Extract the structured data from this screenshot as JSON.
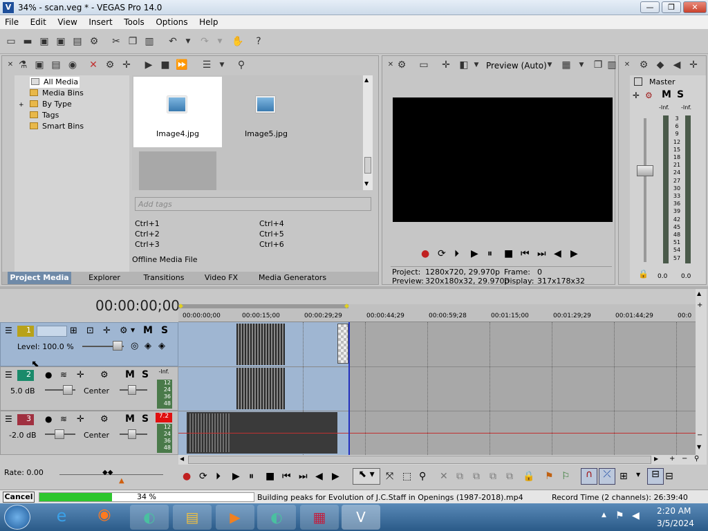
{
  "window": {
    "title": "34% - scan.veg * - VEGAS Pro 14.0",
    "app_icon": "vegas-icon",
    "min": "—",
    "max": "❐",
    "close": "✕"
  },
  "menu": [
    "File",
    "Edit",
    "View",
    "Insert",
    "Tools",
    "Options",
    "Help"
  ],
  "media": {
    "tree": [
      "All Media",
      "Media Bins",
      "By Type",
      "Tags",
      "Smart Bins"
    ],
    "tree_expander": "+",
    "files": [
      "Image4.jpg",
      "Image5.jpg"
    ],
    "tags_placeholder": "Add tags",
    "shortcuts": [
      "Ctrl+1",
      "Ctrl+4",
      "Ctrl+2",
      "Ctrl+5",
      "Ctrl+3",
      "Ctrl+6"
    ],
    "status": "Offline Media File",
    "tabs": [
      "Project Media",
      "Explorer",
      "Transitions",
      "Video FX",
      "Media Generators"
    ]
  },
  "preview": {
    "mode": "Preview (Auto)",
    "project_label": "Project:",
    "project_value": "1280x720, 29.970p",
    "frame_label": "Frame:",
    "frame_value": "0",
    "preview_label": "Preview:",
    "preview_value": "320x180x32, 29.970p",
    "display_label": "Display:",
    "display_value": "317x178x32"
  },
  "mixer": {
    "label": "Master",
    "mute": "M",
    "solo": "S",
    "inf_left": "-Inf.",
    "inf_right": "-Inf.",
    "scale": [
      "3",
      "6",
      "9",
      "12",
      "15",
      "18",
      "21",
      "24",
      "27",
      "30",
      "33",
      "36",
      "39",
      "42",
      "45",
      "48",
      "51",
      "54",
      "57"
    ],
    "bottom_left": "0.0",
    "bottom_right": "0.0"
  },
  "timeline": {
    "timecode": "00:00:00;00",
    "ruler": [
      "00:00:00;00",
      "00:00:15;00",
      "00:00:29;29",
      "00:00:44;29",
      "00:00:59;28",
      "00:01:15;00",
      "00:01:29;29",
      "00:01:44;29",
      "00:0"
    ],
    "tracks": [
      {
        "num": "1",
        "mute": "M",
        "solo": "S",
        "level": "Level: 100.0 %",
        "color": "#b8a21a"
      },
      {
        "num": "2",
        "mute": "M",
        "solo": "S",
        "vol": "5.0 dB",
        "pan": "Center",
        "peak": "-Inf.",
        "meter": [
          "12",
          "24",
          "36",
          "48"
        ],
        "color": "#1a8a6a"
      },
      {
        "num": "3",
        "mute": "M",
        "solo": "S",
        "vol": "-2.0 dB",
        "pan": "Center",
        "peak": "7.2",
        "meter": [
          "12",
          "24",
          "36",
          "48"
        ],
        "color": "#a03040"
      }
    ],
    "rate": "Rate: 0.00"
  },
  "status": {
    "cancel": "Cancel",
    "progress_text": "34 %",
    "progress": 0.34,
    "message": "Building peaks for Evolution of J.C.Staff in Openings (1987-2018).mp4",
    "record_time": "Record Time (2 channels): 26:39:40"
  },
  "taskbar": {
    "time": "2:20 AM",
    "date": "3/5/2024"
  }
}
